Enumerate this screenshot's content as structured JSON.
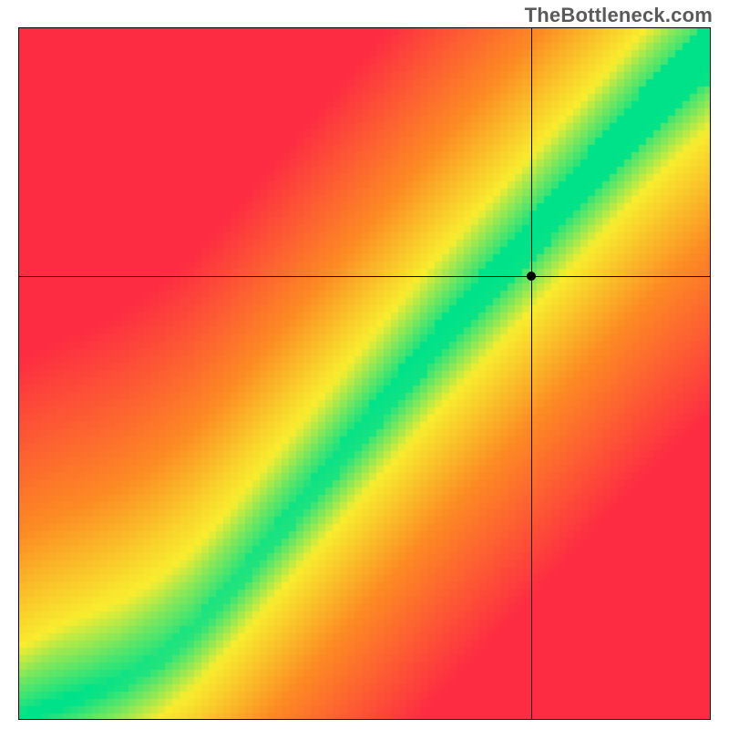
{
  "watermark": "TheBottleneck.com",
  "chart_data": {
    "type": "heatmap",
    "title": "",
    "xlabel": "",
    "ylabel": "",
    "xlim": [
      0,
      1
    ],
    "ylim": [
      0,
      1
    ],
    "crosshair": {
      "x": 0.743,
      "y": 0.64
    },
    "marker": {
      "x": 0.743,
      "y": 0.64
    },
    "ridge": [
      {
        "x": 0.0,
        "y": 0.0
      },
      {
        "x": 0.05,
        "y": 0.02
      },
      {
        "x": 0.1,
        "y": 0.035
      },
      {
        "x": 0.15,
        "y": 0.055
      },
      {
        "x": 0.2,
        "y": 0.085
      },
      {
        "x": 0.25,
        "y": 0.125
      },
      {
        "x": 0.3,
        "y": 0.18
      },
      {
        "x": 0.35,
        "y": 0.24
      },
      {
        "x": 0.4,
        "y": 0.3
      },
      {
        "x": 0.45,
        "y": 0.36
      },
      {
        "x": 0.5,
        "y": 0.42
      },
      {
        "x": 0.55,
        "y": 0.48
      },
      {
        "x": 0.6,
        "y": 0.54
      },
      {
        "x": 0.65,
        "y": 0.595
      },
      {
        "x": 0.7,
        "y": 0.65
      },
      {
        "x": 0.75,
        "y": 0.705
      },
      {
        "x": 0.8,
        "y": 0.76
      },
      {
        "x": 0.85,
        "y": 0.815
      },
      {
        "x": 0.9,
        "y": 0.87
      },
      {
        "x": 0.95,
        "y": 0.92
      },
      {
        "x": 1.0,
        "y": 0.965
      }
    ],
    "ridge_width": [
      {
        "x": 0.0,
        "w": 0.015
      },
      {
        "x": 0.1,
        "w": 0.02
      },
      {
        "x": 0.2,
        "w": 0.025
      },
      {
        "x": 0.3,
        "w": 0.03
      },
      {
        "x": 0.4,
        "w": 0.035
      },
      {
        "x": 0.5,
        "w": 0.042
      },
      {
        "x": 0.6,
        "w": 0.048
      },
      {
        "x": 0.7,
        "w": 0.056
      },
      {
        "x": 0.8,
        "w": 0.063
      },
      {
        "x": 0.9,
        "w": 0.07
      },
      {
        "x": 1.0,
        "w": 0.078
      }
    ],
    "colors": {
      "green": "#00e28a",
      "yellow": "#f9ed2f",
      "orange": "#fd8b24",
      "red": "#fd2c43"
    }
  }
}
